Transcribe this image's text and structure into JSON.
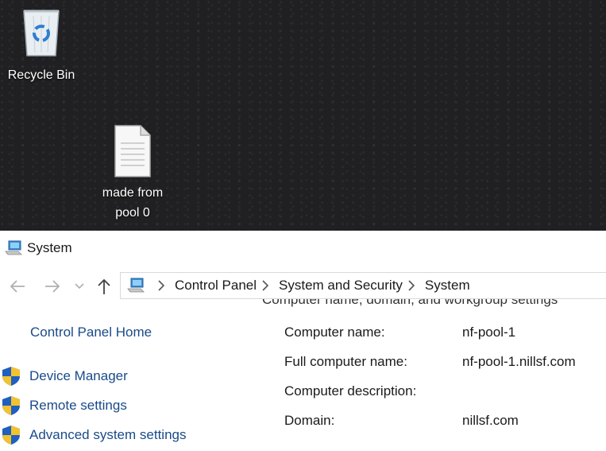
{
  "desktop": {
    "icons": [
      {
        "label": "Recycle Bin",
        "icon": "recycle-bin-icon"
      },
      {
        "label": "made from pool 0",
        "icon": "text-document-icon"
      }
    ]
  },
  "window": {
    "title": "System",
    "title_icon": "system-computer-icon",
    "nav": {
      "back": "back-arrow-icon",
      "forward": "forward-arrow-icon",
      "recent": "chevron-down-icon",
      "up": "up-arrow-icon"
    },
    "breadcrumb": [
      "Control Panel",
      "System and Security",
      "System"
    ],
    "section_heading_clipped": "Computer name, domain, and workgroup settings",
    "left_pane": {
      "home_link": "Control Panel Home",
      "tasks": [
        {
          "label": "Device Manager",
          "icon": "uac-shield-icon"
        },
        {
          "label": "Remote settings",
          "icon": "uac-shield-icon"
        },
        {
          "label": "Advanced system settings",
          "icon": "uac-shield-icon"
        }
      ]
    },
    "computer_info": [
      {
        "label": "Computer name:",
        "value": "nf-pool-1"
      },
      {
        "label": "Full computer name:",
        "value": "nf-pool-1.nillsf.com"
      },
      {
        "label": "Computer description:",
        "value": ""
      },
      {
        "label": "Domain:",
        "value": "nillsf.com"
      }
    ]
  },
  "colors": {
    "link": "#1a4a8a",
    "desktop_bg": "#202022",
    "window_bg": "#ffffff"
  }
}
